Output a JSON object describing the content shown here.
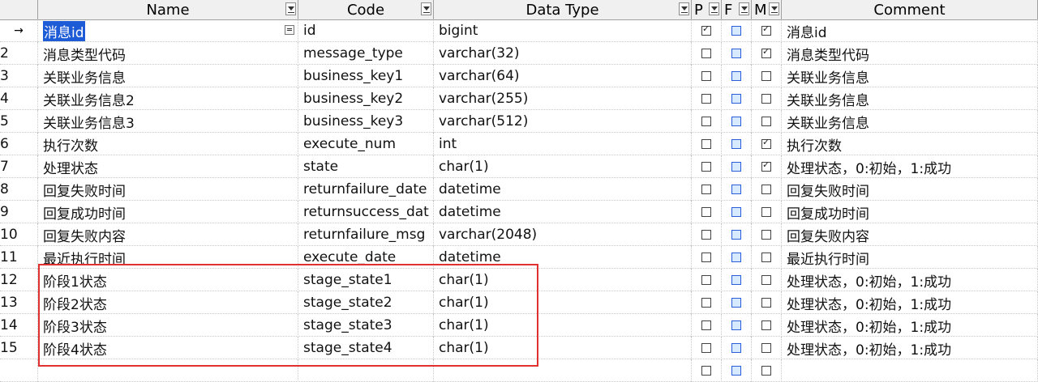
{
  "columns": {
    "name": "Name",
    "code": "Code",
    "data_type": "Data Type",
    "p": "P",
    "f": "F",
    "m": "M",
    "comment": "Comment"
  },
  "current_row_marker": "→",
  "rows": [
    {
      "num": "",
      "name": "消息id",
      "code": "id",
      "type": "bigint",
      "p": true,
      "m": true,
      "comment": "消息id"
    },
    {
      "num": "2",
      "name": "消息类型代码",
      "code": "message_type",
      "type": "varchar(32)",
      "p": false,
      "m": true,
      "comment": "消息类型代码"
    },
    {
      "num": "3",
      "name": "关联业务信息",
      "code": "business_key1",
      "type": "varchar(64)",
      "p": false,
      "m": false,
      "comment": "关联业务信息"
    },
    {
      "num": "4",
      "name": "关联业务信息2",
      "code": "business_key2",
      "type": "varchar(255)",
      "p": false,
      "m": false,
      "comment": "关联业务信息"
    },
    {
      "num": "5",
      "name": "关联业务信息3",
      "code": "business_key3",
      "type": "varchar(512)",
      "p": false,
      "m": false,
      "comment": "关联业务信息"
    },
    {
      "num": "6",
      "name": "执行次数",
      "code": "execute_num",
      "type": "int",
      "p": false,
      "m": true,
      "comment": "执行次数"
    },
    {
      "num": "7",
      "name": "处理状态",
      "code": "state",
      "type": "char(1)",
      "p": false,
      "m": true,
      "comment": "处理状态，0:初始，1:成功"
    },
    {
      "num": "8",
      "name": "回复失败时间",
      "code": "returnfailure_date",
      "type": "datetime",
      "p": false,
      "m": false,
      "comment": "回复失败时间"
    },
    {
      "num": "9",
      "name": "回复成功时间",
      "code": "returnsuccess_dat",
      "type": "datetime",
      "p": false,
      "m": false,
      "comment": "回复成功时间"
    },
    {
      "num": "10",
      "name": "回复失败内容",
      "code": "returnfailure_msg",
      "type": "varchar(2048)",
      "p": false,
      "m": false,
      "comment": "回复失败内容"
    },
    {
      "num": "11",
      "name": "最近执行时间",
      "code": "execute_date",
      "type": "datetime",
      "p": false,
      "m": false,
      "comment": "最近执行时间"
    },
    {
      "num": "12",
      "name": "阶段1状态",
      "code": "stage_state1",
      "type": "char(1)",
      "p": false,
      "m": false,
      "comment": "处理状态，0:初始，1:成功"
    },
    {
      "num": "13",
      "name": "阶段2状态",
      "code": "stage_state2",
      "type": "char(1)",
      "p": false,
      "m": false,
      "comment": "处理状态，0:初始，1:成功"
    },
    {
      "num": "14",
      "name": "阶段3状态",
      "code": "stage_state3",
      "type": "char(1)",
      "p": false,
      "m": false,
      "comment": "处理状态，0:初始，1:成功"
    },
    {
      "num": "15",
      "name": "阶段4状态",
      "code": "stage_state4",
      "type": "char(1)",
      "p": false,
      "m": false,
      "comment": "处理状态，0:初始，1:成功"
    },
    {
      "num": "",
      "name": "",
      "code": "",
      "type": "",
      "p": false,
      "m": false,
      "comment": ""
    }
  ],
  "colors": {
    "selection": "#1e5bd6",
    "highlight_box": "#e03030",
    "foreign_checkbox": "#d6e9ff"
  }
}
